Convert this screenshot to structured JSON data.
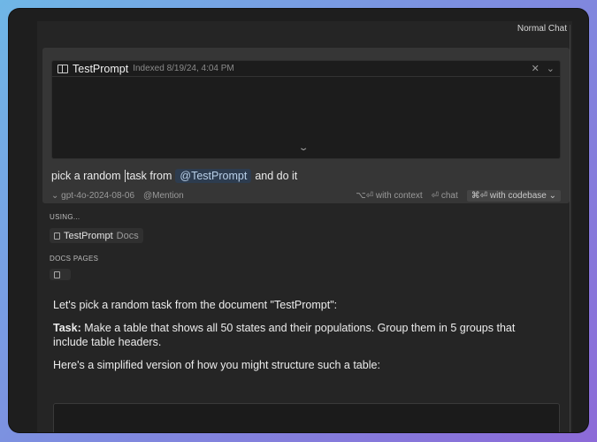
{
  "header": {
    "mode_label": "Normal Chat"
  },
  "doc_card": {
    "title": "TestPrompt",
    "meta": "Indexed 8/19/24, 4:04 PM",
    "close_glyph": "✕",
    "collapse_glyph": "⌄",
    "expand_glyph": "⌄"
  },
  "prompt": {
    "text_before": "pick a random",
    "text_after_caret": "task from",
    "mention": "@TestPrompt",
    "text_end": "and do it"
  },
  "composer_footer": {
    "model": "gpt-4o-2024-08-06",
    "mention": "@Mention",
    "with_context": "⌥⏎ with context",
    "chat": "⏎ chat",
    "with_codebase": "⌘⏎ with codebase"
  },
  "context": {
    "using_label": "USING...",
    "using_item": {
      "name": "TestPrompt",
      "kind": "Docs"
    },
    "docs_pages_label": "DOCS PAGES"
  },
  "answer": {
    "intro": "Let's pick a random task from the document \"TestPrompt\":",
    "task_label": "Task:",
    "task_text": "Make a table that shows all 50 states and their populations. Group them in 5 groups that include table headers.",
    "followup": "Here's a simplified version of how you might structure such a table:"
  }
}
